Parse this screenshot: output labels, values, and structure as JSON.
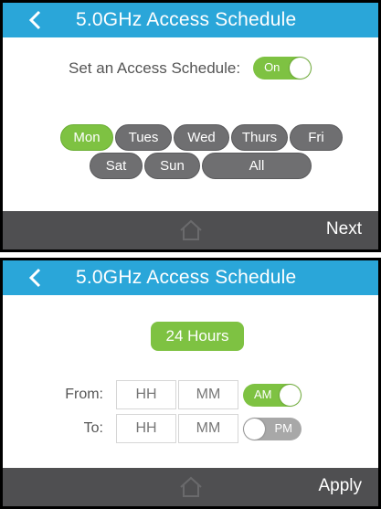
{
  "top_panel": {
    "title": "5.0GHz Access Schedule",
    "schedule_label": "Set an Access Schedule:",
    "schedule_toggle": "On",
    "days_row1": [
      "Mon",
      "Tues",
      "Wed",
      "Thurs",
      "Fri"
    ],
    "days_row2": [
      "Sat",
      "Sun",
      "All"
    ],
    "selected_day": "Mon",
    "footer_action": "Next"
  },
  "bottom_panel": {
    "title": "5.0GHz Access Schedule",
    "hours_button": "24 Hours",
    "from_label": "From:",
    "to_label": "To:",
    "from_hh_placeholder": "HH",
    "from_mm_placeholder": "MM",
    "to_hh_placeholder": "HH",
    "to_mm_placeholder": "MM",
    "from_ampm": "AM",
    "to_ampm": "PM",
    "footer_action": "Apply"
  },
  "colors": {
    "titlebar": "#2aa6d9",
    "accent_green": "#7ec242",
    "button_gray": "#6f6f71",
    "footer": "#4f4f51"
  },
  "icons": {
    "back": "chevron-left-icon",
    "home": "home-icon"
  }
}
